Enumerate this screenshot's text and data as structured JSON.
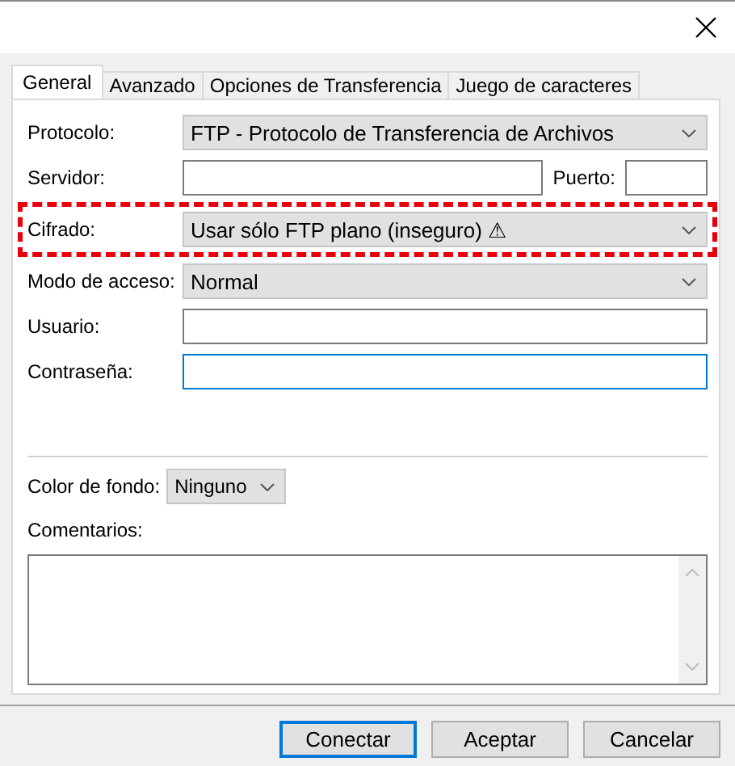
{
  "tabs": [
    {
      "label": "General",
      "selected": true
    },
    {
      "label": "Avanzado",
      "selected": false
    },
    {
      "label": "Opciones de Transferencia",
      "selected": false
    },
    {
      "label": "Juego de caracteres",
      "selected": false
    }
  ],
  "rows": [
    {
      "kind": "select",
      "label": "Protocolo:",
      "value": "FTP - Protocolo de Transferencia de Archivos",
      "highlighted": false
    },
    {
      "kind": "server",
      "label": "Servidor:",
      "port_label": "Puerto:",
      "highlighted": false
    },
    {
      "kind": "select",
      "label": "Cifrado:",
      "value": "Usar sólo FTP plano (inseguro) ⚠",
      "highlighted": true
    },
    {
      "kind": "select",
      "label": "Modo de acceso:",
      "value": "Normal",
      "highlighted": false
    },
    {
      "kind": "input",
      "label": "Usuario:",
      "focused": false,
      "highlighted": false
    },
    {
      "kind": "input",
      "label": "Contraseña:",
      "focused": true,
      "highlighted": false
    }
  ],
  "background_color": {
    "label": "Color de fondo:",
    "value": "Ninguno"
  },
  "comments": {
    "label": "Comentarios:"
  },
  "buttons": [
    {
      "label": "Conectar",
      "default": true
    },
    {
      "label": "Aceptar",
      "default": false
    },
    {
      "label": "Cancelar",
      "default": false
    }
  ]
}
